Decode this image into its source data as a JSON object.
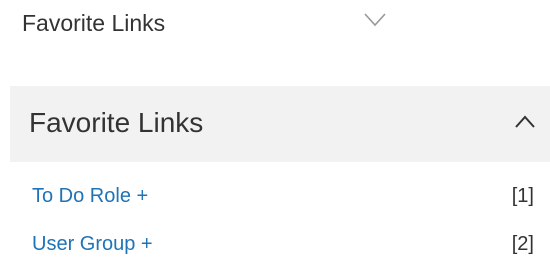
{
  "favorites_collapsed": {
    "title": "Favorite Links",
    "toggle_icon": "chevron-down-icon"
  },
  "favorites_expanded": {
    "title": "Favorite Links",
    "toggle_icon": "chevron-up-icon",
    "links": [
      {
        "label": "To Do Role +",
        "count": "[1]"
      },
      {
        "label": "User Group +",
        "count": "[2]"
      }
    ]
  },
  "colors": {
    "link": "#1f73b7",
    "text": "#333333",
    "header_bg": "#f2f2f2",
    "chevron_collapsed": "#999999",
    "chevron_expanded": "#333333"
  }
}
